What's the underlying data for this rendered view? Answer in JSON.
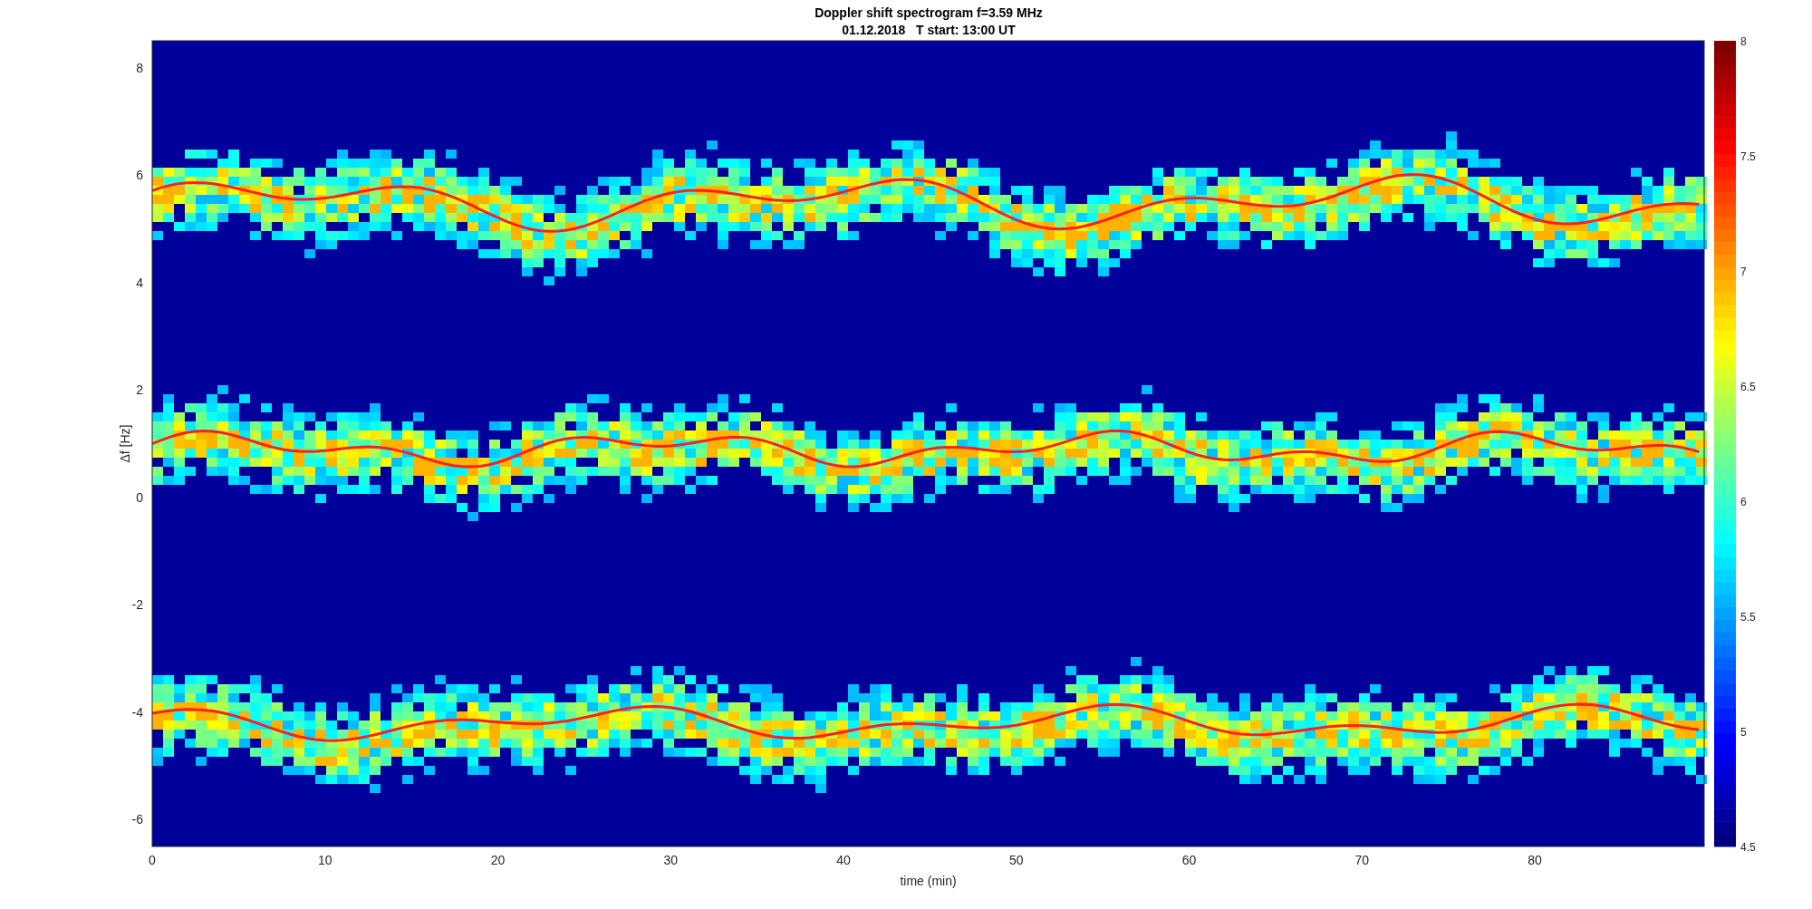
{
  "figure": {
    "title": "Doppler shift spectrogram f=3.59 MHz",
    "subtitle": "01.12.2018   T start: 13:00 UT",
    "xlabel": "time (min)",
    "ylabel": "Δf [Hz]",
    "xticks": [
      "0",
      "10",
      "20",
      "30",
      "40",
      "50",
      "60",
      "70",
      "80"
    ],
    "yticks": [
      "8",
      "6",
      "4",
      "2",
      "0",
      "-2",
      "-4",
      "-6"
    ],
    "colorbar_ticks": [
      "8",
      "7.5",
      "7",
      "6.5",
      "6",
      "5.5",
      "5",
      "4.5"
    ]
  }
}
